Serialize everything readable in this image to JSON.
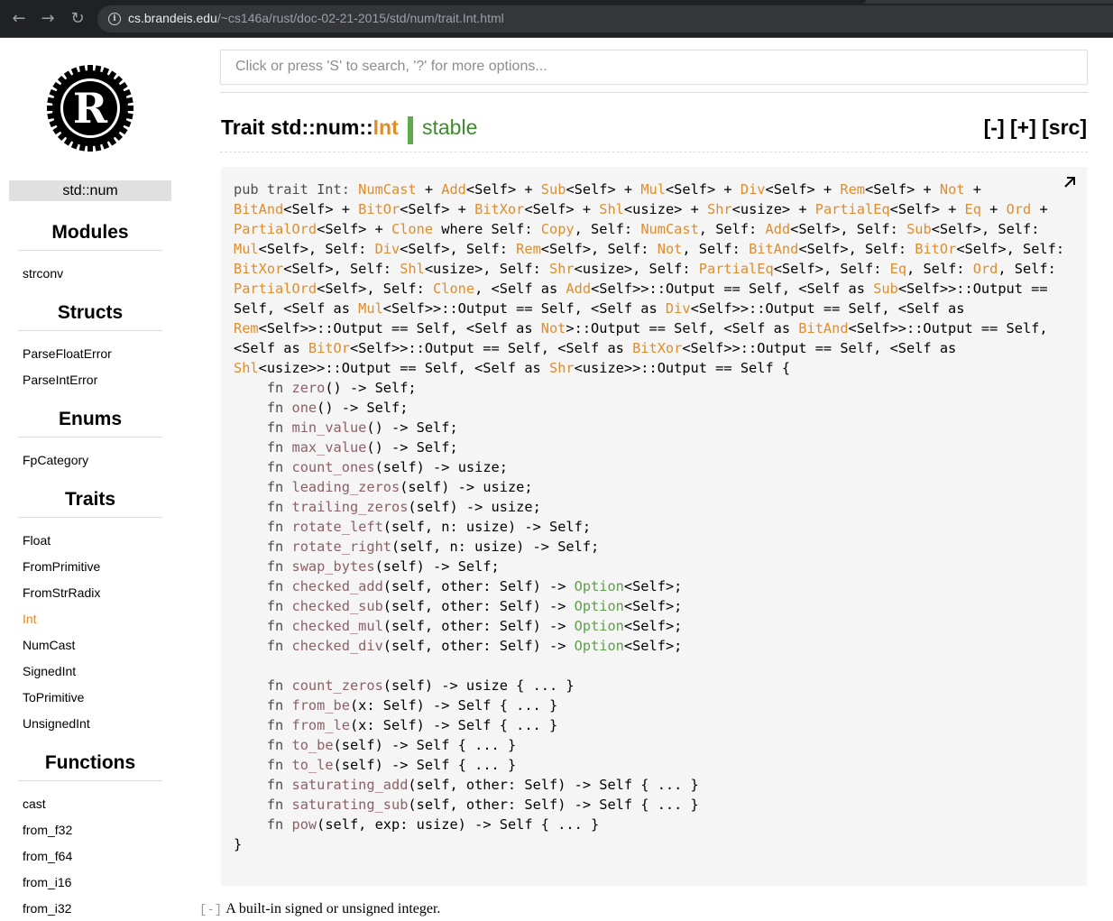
{
  "browser": {
    "url_host": "cs.brandeis.edu",
    "url_path": "/~cs146a/rust/doc-02-21-2015/std/num/trait.Int.html"
  },
  "sidebar": {
    "crate_prefix": "std",
    "crate_sep": "::",
    "crate_module": "num",
    "sections": [
      {
        "title": "Modules",
        "items": [
          "strconv"
        ]
      },
      {
        "title": "Structs",
        "items": [
          "ParseFloatError",
          "ParseIntError"
        ]
      },
      {
        "title": "Enums",
        "items": [
          "FpCategory"
        ]
      },
      {
        "title": "Traits",
        "items": [
          "Float",
          "FromPrimitive",
          "FromStrRadix",
          "Int",
          "NumCast",
          "SignedInt",
          "ToPrimitive",
          "UnsignedInt"
        ]
      },
      {
        "title": "Functions",
        "items": [
          "cast",
          "from_f32",
          "from_f64",
          "from_i16",
          "from_i32"
        ]
      }
    ],
    "current_item": "Int"
  },
  "search": {
    "placeholder": "Click or press 'S' to search, '?' for more options..."
  },
  "heading": {
    "prefix": "Trait std::num::",
    "name": "Int",
    "stability": "stable",
    "controls": "[-] [+] [src]"
  },
  "description": {
    "toggle": "[-]",
    "text": "A built-in signed or unsigned integer."
  },
  "code_lines": [
    [
      [
        "kw",
        "pub trait Int: "
      ],
      [
        "ty",
        "NumCast"
      ],
      [
        "pl",
        " + "
      ],
      [
        "ty",
        "Add"
      ],
      [
        "pl",
        "<Self> + "
      ],
      [
        "ty",
        "Sub"
      ],
      [
        "pl",
        "<Self> + "
      ],
      [
        "ty",
        "Mul"
      ],
      [
        "pl",
        "<Self> + "
      ],
      [
        "ty",
        "Div"
      ],
      [
        "pl",
        "<Self> + "
      ],
      [
        "ty",
        "Rem"
      ],
      [
        "pl",
        "<Self> + "
      ],
      [
        "ty",
        "Not"
      ],
      [
        "pl",
        " + "
      ],
      [
        "ty",
        "BitAnd"
      ],
      [
        "pl",
        "<Self> + "
      ],
      [
        "ty",
        "BitOr"
      ],
      [
        "pl",
        "<Self> + "
      ],
      [
        "ty",
        "BitXor"
      ],
      [
        "pl",
        "<Self> + "
      ],
      [
        "ty",
        "Shl"
      ],
      [
        "pl",
        "<usize> + "
      ],
      [
        "ty",
        "Shr"
      ],
      [
        "pl",
        "<usize> + "
      ],
      [
        "ty",
        "PartialEq"
      ],
      [
        "pl",
        "<Self> + "
      ],
      [
        "ty",
        "Eq"
      ],
      [
        "pl",
        " + "
      ],
      [
        "ty",
        "Ord"
      ],
      [
        "pl",
        " + "
      ],
      [
        "ty",
        "PartialOrd"
      ],
      [
        "pl",
        "<Self> + "
      ],
      [
        "ty",
        "Clone"
      ],
      [
        "pl",
        " where Self: "
      ],
      [
        "ty",
        "Copy"
      ],
      [
        "pl",
        ", Self: "
      ],
      [
        "ty",
        "NumCast"
      ],
      [
        "pl",
        ", Self: "
      ],
      [
        "ty",
        "Add"
      ],
      [
        "pl",
        "<Self>, Self: "
      ],
      [
        "ty",
        "Sub"
      ],
      [
        "pl",
        "<Self>, Self: "
      ],
      [
        "ty",
        "Mul"
      ],
      [
        "pl",
        "<Self>, Self: "
      ],
      [
        "ty",
        "Div"
      ],
      [
        "pl",
        "<Self>, Self: "
      ],
      [
        "ty",
        "Rem"
      ],
      [
        "pl",
        "<Self>, Self: "
      ],
      [
        "ty",
        "Not"
      ],
      [
        "pl",
        ", Self: "
      ],
      [
        "ty",
        "BitAnd"
      ],
      [
        "pl",
        "<Self>, Self: "
      ],
      [
        "ty",
        "BitOr"
      ],
      [
        "pl",
        "<Self>, Self: "
      ],
      [
        "ty",
        "BitXor"
      ],
      [
        "pl",
        "<Self>, Self: "
      ],
      [
        "ty",
        "Shl"
      ],
      [
        "pl",
        "<usize>, Self: "
      ],
      [
        "ty",
        "Shr"
      ],
      [
        "pl",
        "<usize>, Self: "
      ],
      [
        "ty",
        "PartialEq"
      ],
      [
        "pl",
        "<Self>, Self: "
      ],
      [
        "ty",
        "Eq"
      ],
      [
        "pl",
        ", Self: "
      ],
      [
        "ty",
        "Ord"
      ],
      [
        "pl",
        ", Self: "
      ],
      [
        "ty",
        "PartialOrd"
      ],
      [
        "pl",
        "<Self>, Self: "
      ],
      [
        "ty",
        "Clone"
      ],
      [
        "pl",
        ", <Self as "
      ],
      [
        "ty",
        "Add"
      ],
      [
        "pl",
        "<Self>>::Output == Self, <Self as "
      ],
      [
        "ty",
        "Sub"
      ],
      [
        "pl",
        "<Self>>::Output == Self, <Self as "
      ],
      [
        "ty",
        "Mul"
      ],
      [
        "pl",
        "<Self>>::Output == Self, <Self as "
      ],
      [
        "ty",
        "Div"
      ],
      [
        "pl",
        "<Self>>::Output == Self, <Self as "
      ],
      [
        "ty",
        "Rem"
      ],
      [
        "pl",
        "<Self>>::Output == Self, <Self as "
      ],
      [
        "ty",
        "Not"
      ],
      [
        "pl",
        ">::Output == Self, <Self as "
      ],
      [
        "ty",
        "BitAnd"
      ],
      [
        "pl",
        "<Self>>::Output == Self, <Self as "
      ],
      [
        "ty",
        "BitOr"
      ],
      [
        "pl",
        "<Self>>::Output == Self, <Self as "
      ],
      [
        "ty",
        "BitXor"
      ],
      [
        "pl",
        "<Self>>::Output == Self, <Self as "
      ],
      [
        "ty",
        "Shl"
      ],
      [
        "pl",
        "<usize>>::Output == Self, <Self as "
      ],
      [
        "ty",
        "Shr"
      ],
      [
        "pl",
        "<usize>>::Output == Self {"
      ]
    ],
    [
      [
        "kw",
        "    fn "
      ],
      [
        "fnn",
        "zero"
      ],
      [
        "pl",
        "() -> Self;"
      ]
    ],
    [
      [
        "kw",
        "    fn "
      ],
      [
        "fnn",
        "one"
      ],
      [
        "pl",
        "() -> Self;"
      ]
    ],
    [
      [
        "kw",
        "    fn "
      ],
      [
        "fnn",
        "min_value"
      ],
      [
        "pl",
        "() -> Self;"
      ]
    ],
    [
      [
        "kw",
        "    fn "
      ],
      [
        "fnn",
        "max_value"
      ],
      [
        "pl",
        "() -> Self;"
      ]
    ],
    [
      [
        "kw",
        "    fn "
      ],
      [
        "fnn",
        "count_ones"
      ],
      [
        "pl",
        "(self) -> usize;"
      ]
    ],
    [
      [
        "kw",
        "    fn "
      ],
      [
        "fnn",
        "leading_zeros"
      ],
      [
        "pl",
        "(self) -> usize;"
      ]
    ],
    [
      [
        "kw",
        "    fn "
      ],
      [
        "fnn",
        "trailing_zeros"
      ],
      [
        "pl",
        "(self) -> usize;"
      ]
    ],
    [
      [
        "kw",
        "    fn "
      ],
      [
        "fnn",
        "rotate_left"
      ],
      [
        "pl",
        "(self, n: usize) -> Self;"
      ]
    ],
    [
      [
        "kw",
        "    fn "
      ],
      [
        "fnn",
        "rotate_right"
      ],
      [
        "pl",
        "(self, n: usize) -> Self;"
      ]
    ],
    [
      [
        "kw",
        "    fn "
      ],
      [
        "fnn",
        "swap_bytes"
      ],
      [
        "pl",
        "(self) -> Self;"
      ]
    ],
    [
      [
        "kw",
        "    fn "
      ],
      [
        "fnn",
        "checked_add"
      ],
      [
        "pl",
        "(self, other: Self) -> "
      ],
      [
        "en",
        "Option"
      ],
      [
        "pl",
        "<Self>;"
      ]
    ],
    [
      [
        "kw",
        "    fn "
      ],
      [
        "fnn",
        "checked_sub"
      ],
      [
        "pl",
        "(self, other: Self) -> "
      ],
      [
        "en",
        "Option"
      ],
      [
        "pl",
        "<Self>;"
      ]
    ],
    [
      [
        "kw",
        "    fn "
      ],
      [
        "fnn",
        "checked_mul"
      ],
      [
        "pl",
        "(self, other: Self) -> "
      ],
      [
        "en",
        "Option"
      ],
      [
        "pl",
        "<Self>;"
      ]
    ],
    [
      [
        "kw",
        "    fn "
      ],
      [
        "fnn",
        "checked_div"
      ],
      [
        "pl",
        "(self, other: Self) -> "
      ],
      [
        "en",
        "Option"
      ],
      [
        "pl",
        "<Self>;"
      ]
    ],
    [
      [
        "pl",
        ""
      ]
    ],
    [
      [
        "kw",
        "    fn "
      ],
      [
        "fnn",
        "count_zeros"
      ],
      [
        "pl",
        "(self) -> usize { ... }"
      ]
    ],
    [
      [
        "kw",
        "    fn "
      ],
      [
        "fnn",
        "from_be"
      ],
      [
        "pl",
        "(x: Self) -> Self { ... }"
      ]
    ],
    [
      [
        "kw",
        "    fn "
      ],
      [
        "fnn",
        "from_le"
      ],
      [
        "pl",
        "(x: Self) -> Self { ... }"
      ]
    ],
    [
      [
        "kw",
        "    fn "
      ],
      [
        "fnn",
        "to_be"
      ],
      [
        "pl",
        "(self) -> Self { ... }"
      ]
    ],
    [
      [
        "kw",
        "    fn "
      ],
      [
        "fnn",
        "to_le"
      ],
      [
        "pl",
        "(self) -> Self { ... }"
      ]
    ],
    [
      [
        "kw",
        "    fn "
      ],
      [
        "fnn",
        "saturating_add"
      ],
      [
        "pl",
        "(self, other: Self) -> Self { ... }"
      ]
    ],
    [
      [
        "kw",
        "    fn "
      ],
      [
        "fnn",
        "saturating_sub"
      ],
      [
        "pl",
        "(self, other: Self) -> Self { ... }"
      ]
    ],
    [
      [
        "kw",
        "    fn "
      ],
      [
        "fnn",
        "pow"
      ],
      [
        "pl",
        "(self, exp: usize) -> Self { ... }"
      ]
    ],
    [
      [
        "pl",
        "}"
      ]
    ]
  ],
  "colors": {
    "type": "#df8d2b",
    "fn_name": "#8c6067",
    "enum": "#5e9e4b",
    "stable_bar": "#5daa4f"
  }
}
